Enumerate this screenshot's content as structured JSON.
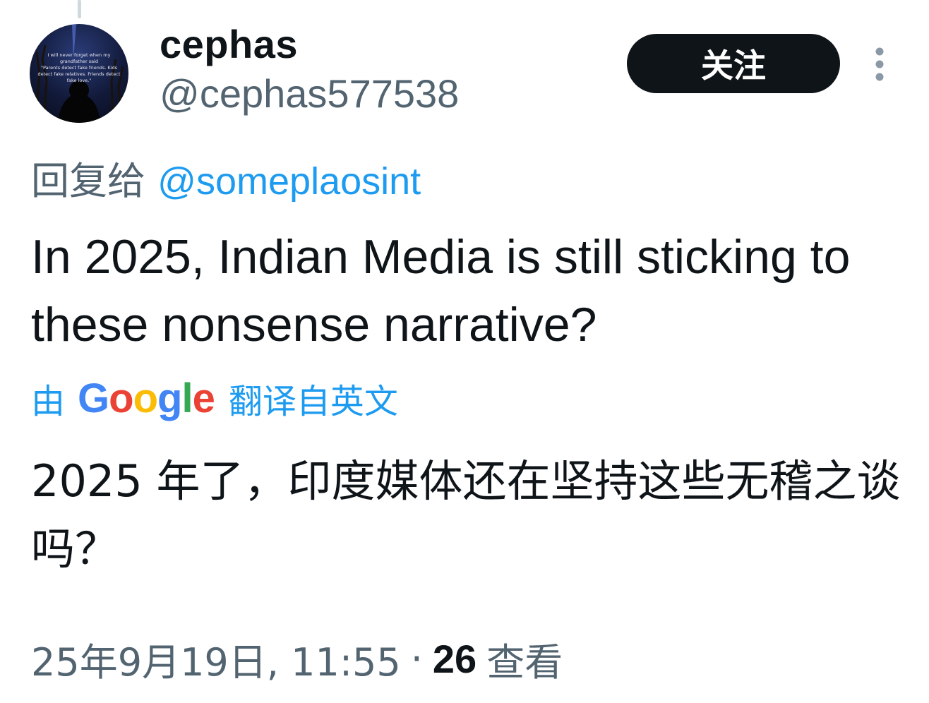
{
  "author": {
    "display_name": "cephas",
    "handle": "@cephas577538",
    "avatar_quote": "I will never forget when my grandfather said \"Parents detect fake friends. Kids detect fake relatives. Friends detect fake love.\""
  },
  "actions": {
    "follow_label": "关注",
    "more_icon": "more-vertical-icon"
  },
  "reply": {
    "prefix": "回复给",
    "mention": "@someplaosint"
  },
  "tweet": {
    "text": "In 2025, Indian Media is still sticking to these nonsense narrative?"
  },
  "translation": {
    "by": "由",
    "provider": "Google",
    "suffix": "翻译自英文",
    "text": "2025 年了，印度媒体还在坚持这些无稽之谈吗？"
  },
  "meta": {
    "timestamp": "25年9月19日, 11:55",
    "separator": "·",
    "views_count": "26",
    "views_label": "查看"
  },
  "colors": {
    "accent": "#1d9bf0",
    "text_primary": "#0f1419",
    "text_secondary": "#536471",
    "button_bg": "#0f1419"
  }
}
